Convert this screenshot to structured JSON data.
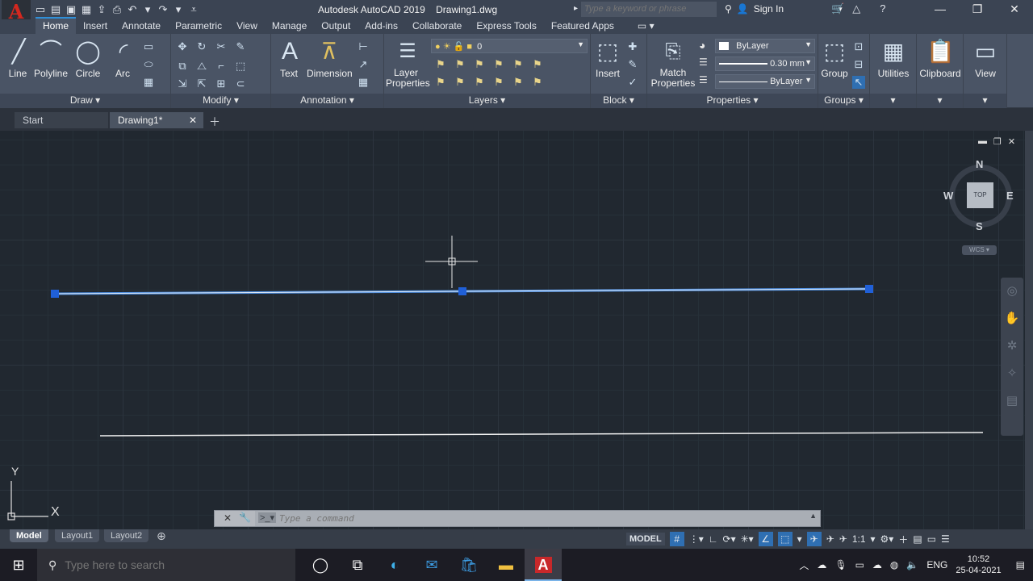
{
  "title_bar": {
    "app_title": "Autodesk AutoCAD 2019",
    "file_name": "Drawing1.dwg",
    "search_placeholder": "Type a keyword or phrase",
    "sign_in": "Sign In"
  },
  "ribbon_tabs": [
    "Home",
    "Insert",
    "Annotate",
    "Parametric",
    "View",
    "Manage",
    "Output",
    "Add-ins",
    "Collaborate",
    "Express Tools",
    "Featured Apps"
  ],
  "ribbon": {
    "draw": {
      "title": "Draw",
      "line": "Line",
      "polyline": "Polyline",
      "circle": "Circle",
      "arc": "Arc"
    },
    "modify": {
      "title": "Modify"
    },
    "annotation": {
      "title": "Annotation",
      "text": "Text",
      "dimension": "Dimension"
    },
    "layers": {
      "title": "Layers",
      "layer_properties": "Layer Properties",
      "current_layer": "0"
    },
    "block": {
      "title": "Block",
      "insert": "Insert"
    },
    "properties": {
      "title": "Properties",
      "match_properties": "Match Properties",
      "color": "ByLayer",
      "lineweight": "0.30 mm",
      "linetype": "ByLayer"
    },
    "groups": {
      "title": "Groups",
      "group": "Group"
    },
    "utilities": "Utilities",
    "clipboard": "Clipboard",
    "view": "View"
  },
  "doc_tabs": {
    "start": "Start",
    "drawing": "Drawing1*"
  },
  "viewcube": {
    "north": "N",
    "south": "S",
    "east": "E",
    "west": "W",
    "top": "TOP",
    "wcs": "WCS"
  },
  "ucs": {
    "x": "X",
    "y": "Y"
  },
  "command_line": {
    "placeholder": "Type a command"
  },
  "layout_tabs": [
    "Model",
    "Layout1",
    "Layout2"
  ],
  "status_bar": {
    "model": "MODEL",
    "scale": "1:1"
  },
  "taskbar": {
    "search_placeholder": "Type here to search",
    "language": "ENG",
    "time": "10:52",
    "date": "25-04-2021"
  }
}
